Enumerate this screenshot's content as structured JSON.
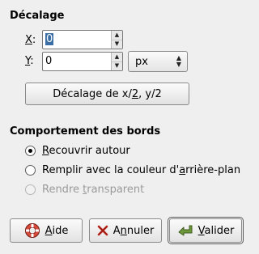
{
  "offset_section": {
    "title": "Décalage",
    "x_label": "X",
    "x_label_rest": ":",
    "x_value": "0",
    "y_label": "Y",
    "y_label_rest": ":",
    "y_value": "0",
    "unit": "px",
    "half_button_prefix": "Décalage de x/",
    "half_button_mnemonic": "2",
    "half_button_suffix": ", y/2"
  },
  "edge_section": {
    "title": "Comportement des bords",
    "options": [
      {
        "pre": "",
        "mn": "R",
        "post": "ecouvrir autour",
        "selected": true,
        "disabled": false
      },
      {
        "pre": "Remplir avec la couleur d'",
        "mn": "a",
        "post": "rrière-plan",
        "selected": false,
        "disabled": false
      },
      {
        "pre": "Rendre ",
        "mn": "t",
        "post": "ransparent",
        "selected": false,
        "disabled": true
      }
    ]
  },
  "buttons": {
    "help_mn": "A",
    "help_rest": "ide",
    "cancel_pre": "A",
    "cancel_mn": "n",
    "cancel_rest": "nuler",
    "ok_mn": "V",
    "ok_rest": "alider"
  }
}
